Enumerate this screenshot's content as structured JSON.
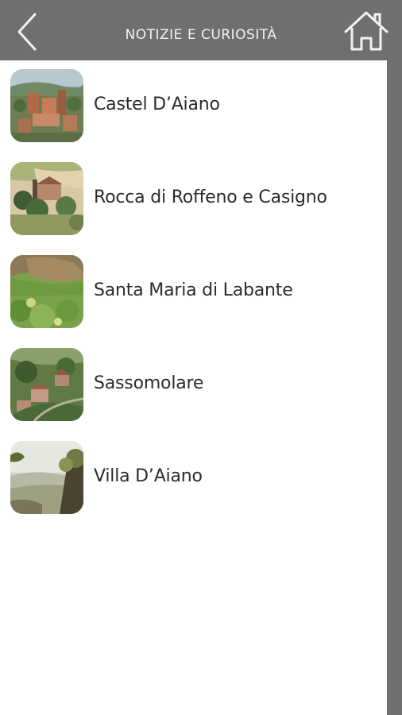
{
  "header": {
    "title": "NOTIZIE E CURIOSITÀ",
    "back_icon": "chevron-left-icon",
    "home_icon": "home-icon"
  },
  "colors": {
    "header_bg": "#6f6f6f",
    "header_text": "#f2f2f2",
    "list_bg": "#ffffff",
    "item_text": "#2b2b2b"
  },
  "items": [
    {
      "label": "Castel D’Aiano",
      "thumbnail": "castel-daiano-photo"
    },
    {
      "label": "Rocca di Roffeno e Casigno",
      "thumbnail": "rocca-di-roffeno-photo"
    },
    {
      "label": "Santa Maria di Labante",
      "thumbnail": "santa-maria-di-labante-photo"
    },
    {
      "label": "Sassomolare",
      "thumbnail": "sassomolare-photo"
    },
    {
      "label": "Villa D’Aiano",
      "thumbnail": "villa-daiano-photo"
    }
  ]
}
